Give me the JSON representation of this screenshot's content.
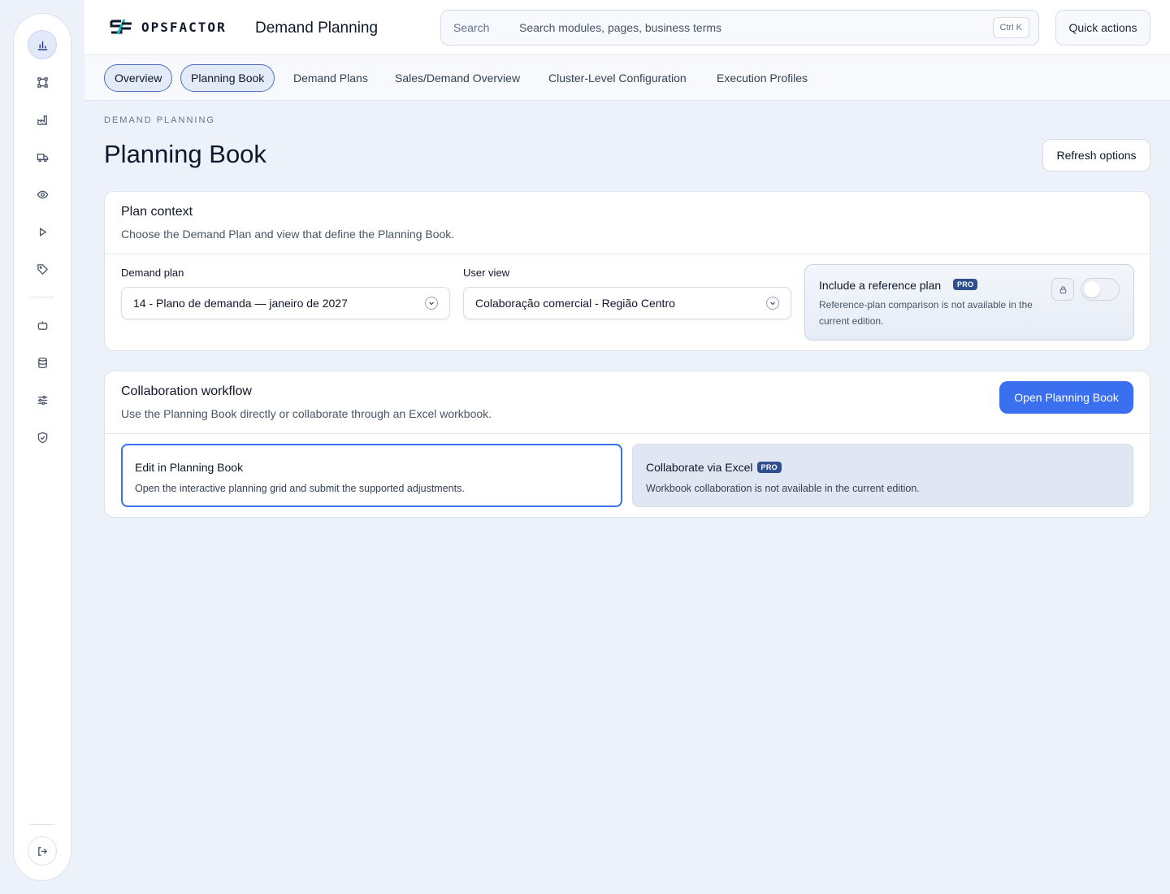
{
  "brand": {
    "name": "OPSFACTOR",
    "app_title": "Demand Planning"
  },
  "search": {
    "label": "Search",
    "placeholder": "Search modules, pages, business terms",
    "shortcut": "Ctrl K"
  },
  "header": {
    "quick_actions": "Quick actions"
  },
  "rail": {
    "items": [
      "chart-bar-icon",
      "workflow-icon",
      "factory-icon",
      "truck-icon",
      "eye-icon",
      "play-icon",
      "tag-icon",
      "robot-icon",
      "database-icon",
      "sliders-icon",
      "shield-check-icon"
    ],
    "logout": "logout-icon"
  },
  "tabs": [
    "Overview",
    "Planning Book",
    "Demand Plans",
    "Sales/Demand Overview",
    "Cluster-Level Configuration",
    "Execution Profiles"
  ],
  "page": {
    "eyebrow": "DEMAND PLANNING",
    "title": "Planning Book",
    "refresh": "Refresh options"
  },
  "plan_context": {
    "title": "Plan context",
    "subtitle": "Choose the Demand Plan and view that define the Planning Book.",
    "demand_plan_label": "Demand plan",
    "demand_plan_value": "14 - Plano de demanda — janeiro de 2027",
    "user_view_label": "User view",
    "user_view_value": "Colaboração comercial - Região Centro",
    "reference": {
      "title": "Include a reference plan",
      "badge": "PRO",
      "text": "Reference-plan comparison is not available in the current edition."
    }
  },
  "collab": {
    "title": "Collaboration workflow",
    "subtitle": "Use the Planning Book directly or collaborate through an Excel workbook.",
    "open_button": "Open Planning Book",
    "option1_title": "Edit in Planning Book",
    "option1_text": "Open the interactive planning grid and submit the supported adjustments.",
    "option2_title": "Collaborate via Excel",
    "option2_badge": "PRO",
    "option2_text": "Workbook collaboration is not available in the current edition."
  },
  "colors": {
    "accent": "#3a6ff0",
    "pro_badge": "#2f4f8f",
    "background": "#edf1f9"
  }
}
